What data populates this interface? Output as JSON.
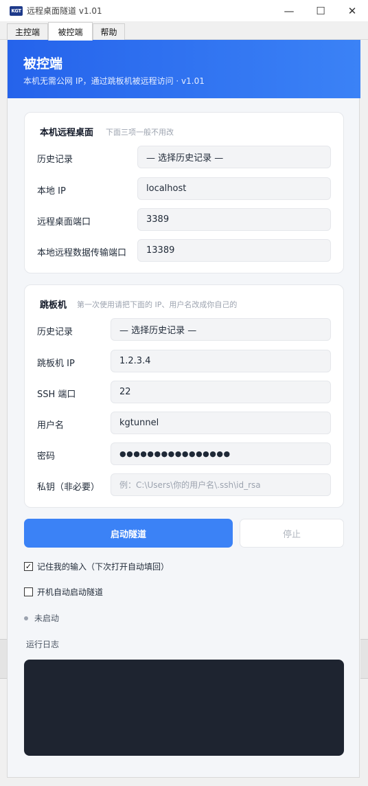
{
  "window": {
    "logo_text": "KGT",
    "title": "远程桌面隧道 v1.01",
    "controls": {
      "minimize": "—",
      "maximize": "☐",
      "close": "✕"
    }
  },
  "tabs": [
    {
      "label": "主控端"
    },
    {
      "label": "被控端"
    },
    {
      "label": "帮助"
    }
  ],
  "header": {
    "title": "被控端",
    "subtitle": "本机无需公网 IP，通过跳板机被远程访问 · v1.01"
  },
  "local_card": {
    "title": "本机远程桌面",
    "hint": "下面三项一般不用改",
    "rows": [
      {
        "label": "历史记录",
        "value": "— 选择历史记录 —"
      },
      {
        "label": "本地 IP",
        "value": "localhost"
      },
      {
        "label": "远程桌面端口",
        "value": "3389"
      },
      {
        "label": "本地远程数据传输端口",
        "value": "13389"
      }
    ]
  },
  "jump_card": {
    "title": "跳板机",
    "hint": "第一次使用请把下面的 IP、用户名改成你自己的",
    "rows": [
      {
        "label": "历史记录",
        "value": "— 选择历史记录 —"
      },
      {
        "label": "跳板机 IP",
        "value": "1.2.3.4"
      },
      {
        "label": "SSH 端口",
        "value": "22"
      },
      {
        "label": "用户名",
        "value": "kgtunnel"
      },
      {
        "label": "密码",
        "value": "●●●●●●●●●●●●●●●●"
      },
      {
        "label": "私钥（非必要）",
        "placeholder": "例：C:\\Users\\你的用户名\\.ssh\\id_rsa"
      }
    ]
  },
  "actions": {
    "start_label": "启动隧道",
    "stop_label": "停止"
  },
  "options": {
    "remember": {
      "label": "记住我的输入（下次打开自动填回）",
      "checked": true,
      "mark": "✓"
    },
    "autostart": {
      "label": "开机自动启动隧道",
      "checked": false
    }
  },
  "status": {
    "text": "未启动"
  },
  "log": {
    "label": "运行日志"
  }
}
